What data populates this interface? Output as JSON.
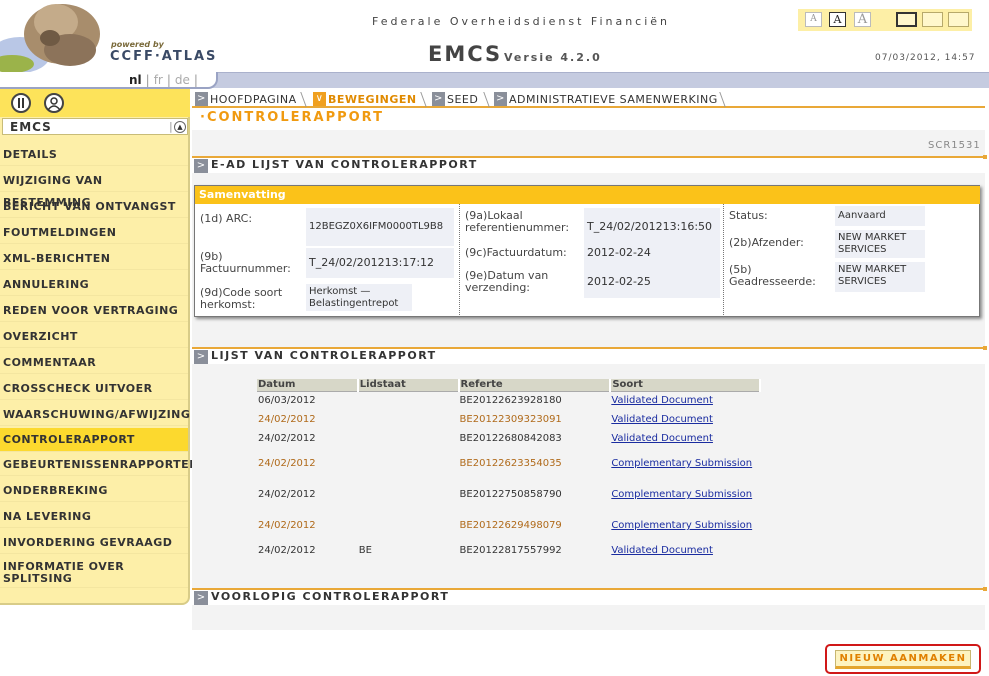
{
  "header": {
    "powered_by": "powered by",
    "brand": "CCFF·ATLAS",
    "agency": "Federale Overheidsdienst Financiën",
    "app_title": "EMCS",
    "app_version": "Versie 4.2.0",
    "datetime": "07/03/2012, 14:57",
    "font_sizes": [
      "A",
      "A",
      "A"
    ]
  },
  "languages": [
    {
      "code": "nl",
      "active": true
    },
    {
      "code": "fr",
      "active": false
    },
    {
      "code": "de",
      "active": false
    }
  ],
  "sidebar": {
    "heading": "EMCS",
    "items": [
      {
        "label": "DETAILS"
      },
      {
        "label": "WIJZIGING VAN BESTEMMING"
      },
      {
        "label": "BERICHT VAN ONTVANGST"
      },
      {
        "label": "FOUTMELDINGEN"
      },
      {
        "label": "XML-BERICHTEN"
      },
      {
        "label": "ANNULERING"
      },
      {
        "label": "REDEN VOOR VERTRAGING"
      },
      {
        "label": "OVERZICHT"
      },
      {
        "label": "COMMENTAAR"
      },
      {
        "label": "CROSSCHECK UITVOER"
      },
      {
        "label": "WAARSCHUWING/AFWIJZING"
      },
      {
        "label": "CONTROLERAPPORT",
        "active": true
      },
      {
        "label": "GEBEURTENISSENRAPPORTEN"
      },
      {
        "label": "ONDERBREKING"
      },
      {
        "label": "NA LEVERING"
      },
      {
        "label": "INVORDERING GEVRAAGD"
      },
      {
        "label": "INFORMATIE OVER SPLITSING"
      }
    ]
  },
  "tabs": [
    {
      "label": "HOOFDPAGINA",
      "active": false
    },
    {
      "label": "BEWEGINGEN",
      "active": true
    },
    {
      "label": "SEED",
      "active": false
    },
    {
      "label": "ADMINISTRATIEVE SAMENWERKING",
      "active": false
    }
  ],
  "page_title": "·CONTROLERAPPORT",
  "screen_id": "SCR1531",
  "sections": {
    "ead": "E-AD LIJST VAN CONTROLERAPPORT",
    "list": "LIJST VAN CONTROLERAPPORT",
    "prelim": "VOORLOPIG CONTROLERAPPORT"
  },
  "summary": {
    "title": "Samenvatting",
    "col1": [
      {
        "label": "(1d) ARC:",
        "value": "12BEGZ0X6IFM0000TL9B8"
      },
      {
        "label": "(9b) Factuurnummer:",
        "value": "T_24/02/201213:17:12"
      },
      {
        "label": "(9d)Code soort herkomst:",
        "value": "Herkomst — Belastingentrepot"
      }
    ],
    "col2": [
      {
        "label": "(9a)Lokaal referentienummer:",
        "value": "T_24/02/201213:16:50"
      },
      {
        "label": "(9c)Factuurdatum:",
        "value": "2012-02-24"
      },
      {
        "label": "(9e)Datum van verzending:",
        "value": "2012-02-25"
      }
    ],
    "col3": [
      {
        "label": "Status:",
        "value": "Aanvaard"
      },
      {
        "label": "(2b)Afzender:",
        "value": "NEW MARKET SERVICES"
      },
      {
        "label": "(5b) Geadresseerde:",
        "value": "NEW MARKET SERVICES"
      }
    ]
  },
  "list_table": {
    "columns": [
      "Datum",
      "Lidstaat",
      "Referte",
      "Soort"
    ],
    "rows": [
      {
        "datum": "06/03/2012",
        "lidstaat": "",
        "referte": "BE20122623928180",
        "soort": "Validated Document"
      },
      {
        "datum": "24/02/2012",
        "lidstaat": "",
        "referte": "BE20122309323091",
        "soort": "Validated Document"
      },
      {
        "datum": "24/02/2012",
        "lidstaat": "",
        "referte": "BE20122680842083",
        "soort": "Validated Document"
      },
      {
        "datum": "24/02/2012",
        "lidstaat": "",
        "referte": "BE20122623354035",
        "soort": "Complementary Submission"
      },
      {
        "datum": "24/02/2012",
        "lidstaat": "",
        "referte": "BE20122750858790",
        "soort": "Complementary Submission"
      },
      {
        "datum": "24/02/2012",
        "lidstaat": "",
        "referte": "BE20122629498079",
        "soort": "Complementary Submission"
      },
      {
        "datum": "24/02/2012",
        "lidstaat": "BE",
        "referte": "BE20122817557992",
        "soort": "Validated Document"
      }
    ]
  },
  "buttons": {
    "new": "NIEUW AANMAKEN"
  },
  "colors": {
    "accent": "#f09a10",
    "sidebar_bg": "#fdefa8",
    "active_item": "#fcd92e",
    "summary_bar": "#fbc219",
    "link": "#1a2ca0"
  }
}
